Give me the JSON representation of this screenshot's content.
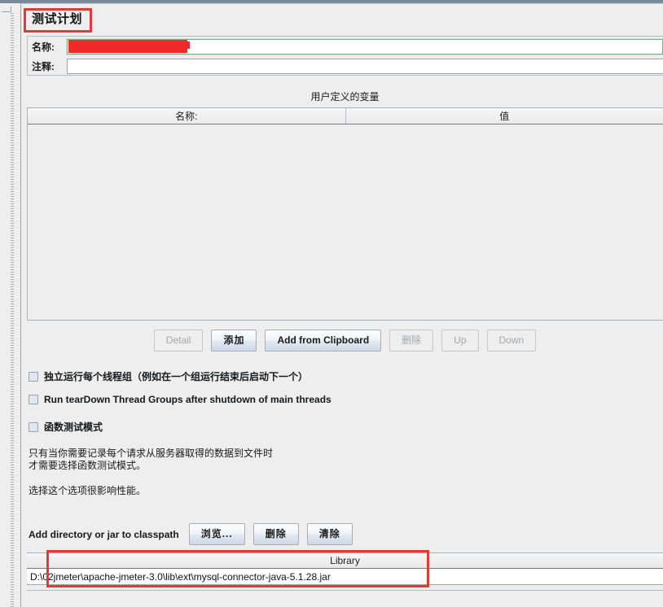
{
  "window": {
    "title": "测试计划"
  },
  "form": {
    "name_label": "名称:",
    "name_value": "",
    "comment_label": "注释:",
    "comment_value": ""
  },
  "user_defined_variables": {
    "section_title": "用户定义的变量",
    "columns": [
      "名称:",
      "值"
    ],
    "rows": []
  },
  "variable_buttons": [
    {
      "label": "Detail",
      "enabled": false
    },
    {
      "label": "添加",
      "enabled": true
    },
    {
      "label": "Add from Clipboard",
      "enabled": true
    },
    {
      "label": "删除",
      "enabled": false
    },
    {
      "label": "Up",
      "enabled": false
    },
    {
      "label": "Down",
      "enabled": false
    }
  ],
  "options": [
    {
      "label": "独立运行每个线程组（例如在一个组运行结束后启动下一个）",
      "checked": false
    },
    {
      "label": "Run tearDown Thread Groups after shutdown of main threads",
      "checked": false
    },
    {
      "label": "函数测试模式",
      "checked": false
    }
  ],
  "notes": {
    "line1": "只有当你需要记录每个请求从服务器取得的数据到文件时",
    "line2": "才需要选择函数测试模式。",
    "line3": "选择这个选项很影响性能。"
  },
  "classpath": {
    "label": "Add directory or jar to classpath",
    "buttons": [
      {
        "label": "浏览...",
        "enabled": true
      },
      {
        "label": "删除",
        "enabled": true
      },
      {
        "label": "清除",
        "enabled": true
      }
    ]
  },
  "library_table": {
    "column_header": "Library",
    "rows": [
      "D:\\02jmeter\\apache-jmeter-3.0\\lib\\ext\\mysql-connector-java-5.1.28.jar"
    ]
  },
  "colors": {
    "annotation_red": "#e03a3a",
    "redaction_red": "#f02a2a",
    "panel_bg": "#eeeeee",
    "titlebar": "#7b8a9b"
  }
}
